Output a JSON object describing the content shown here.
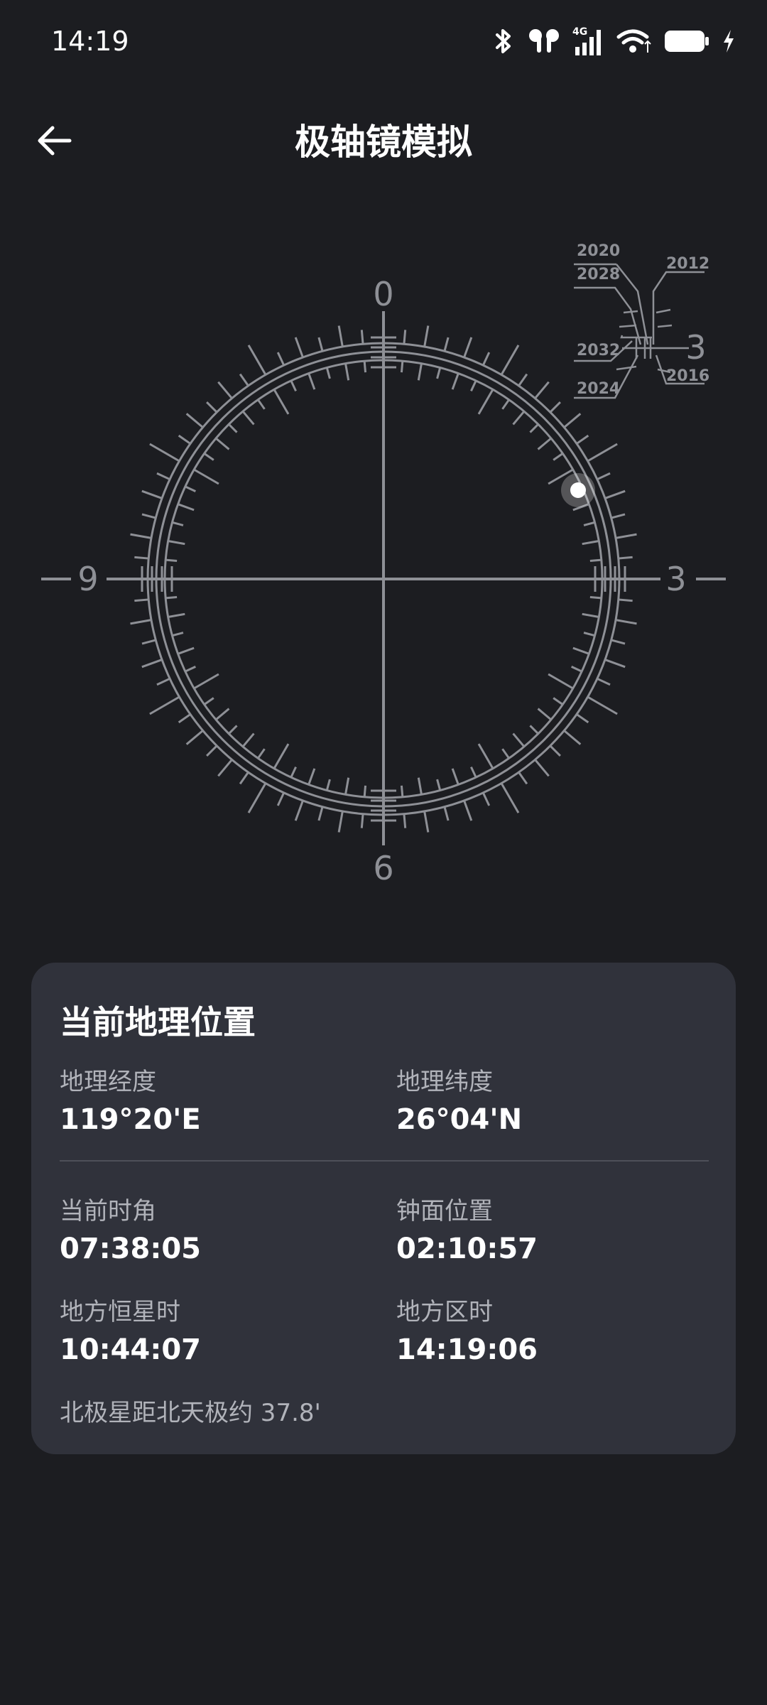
{
  "status_bar": {
    "time": "14:19",
    "network": "4G",
    "icons": [
      "bluetooth-icon",
      "earbuds-icon",
      "cellular-signal-icon",
      "wifi-icon",
      "battery-icon",
      "charging-icon"
    ]
  },
  "header": {
    "title": "极轴镜模拟",
    "back_icon": "arrow-left-icon"
  },
  "reticle": {
    "labels": {
      "top": "0",
      "right": "3",
      "bottom": "6",
      "left": "9"
    },
    "inset": {
      "years_left": [
        "2020",
        "2028",
        "2032",
        "2024"
      ],
      "years_right": [
        "2012",
        "2016"
      ],
      "hour": "3"
    },
    "polaris_clock_position": "02:10:57",
    "colors": {
      "reticle": "#8e9096",
      "marker": "#ffffff",
      "background": "#1c1d21"
    }
  },
  "location": {
    "title": "当前地理位置",
    "longitude_label": "地理经度",
    "longitude": "119°20'E",
    "latitude_label": "地理纬度",
    "latitude": "26°04'N",
    "hour_angle_label": "当前时角",
    "hour_angle": "07:38:05",
    "clock_position_label": "钟面位置",
    "clock_position": "02:10:57",
    "sidereal_time_label": "地方恒星时",
    "sidereal_time": "10:44:07",
    "local_time_label": "地方区时",
    "local_time": "14:19:06",
    "polaris_note": "北极星距北天极约 37.8'"
  }
}
